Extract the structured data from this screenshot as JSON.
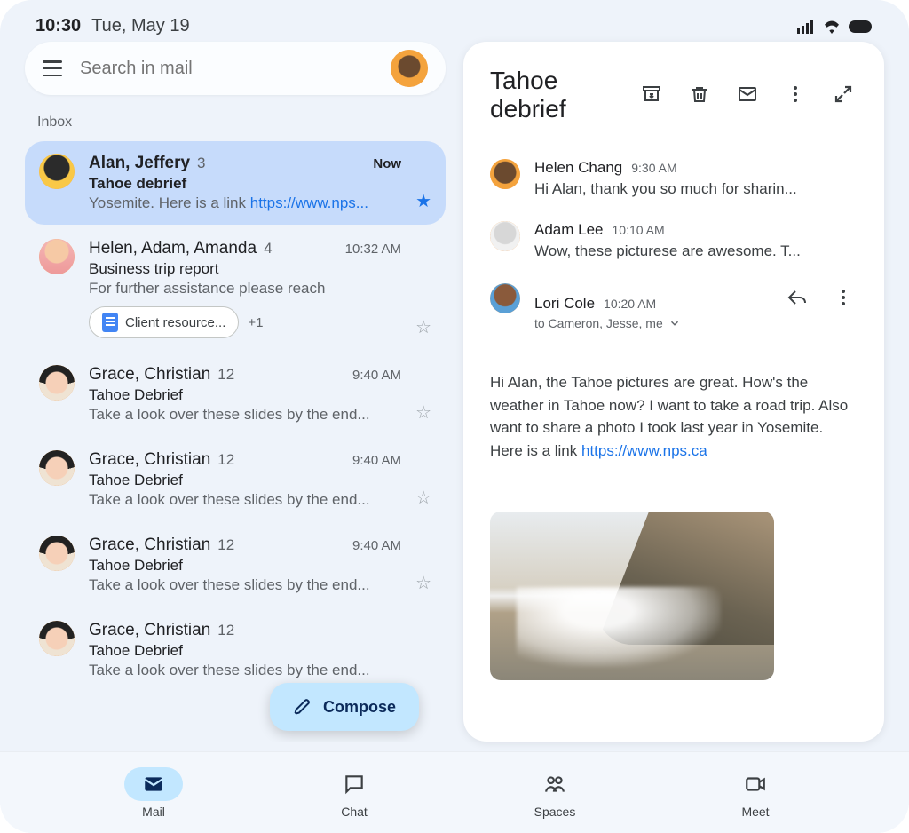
{
  "status": {
    "time": "10:30",
    "date": "Tue, May 19"
  },
  "search": {
    "placeholder": "Search in mail"
  },
  "section_label": "Inbox",
  "compose_label": "Compose",
  "threads": [
    {
      "senders": "Alan, Jeffery",
      "count": "3",
      "time": "Now",
      "subject": "Tahoe debrief",
      "snippet_prefix": "Yosemite. Here is a link ",
      "snippet_link": "https://www.nps...",
      "selected": true,
      "unread": true,
      "starred": true
    },
    {
      "senders": "Helen, Adam, Amanda",
      "count": "4",
      "time": "10:32 AM",
      "subject": "Business trip report",
      "snippet": "For further assistance please reach",
      "chip_label": "Client resource...",
      "chip_more": "+1",
      "selected": false,
      "unread": false,
      "starred": false
    },
    {
      "senders": "Grace, Christian",
      "count": "12",
      "time": "9:40 AM",
      "subject": "Tahoe Debrief",
      "snippet": "Take a look over these slides by the end...",
      "selected": false,
      "unread": false,
      "starred": false
    },
    {
      "senders": "Grace, Christian",
      "count": "12",
      "time": "9:40 AM",
      "subject": "Tahoe Debrief",
      "snippet": "Take a look over these slides by the end...",
      "selected": false,
      "unread": false,
      "starred": false
    },
    {
      "senders": "Grace, Christian",
      "count": "12",
      "time": "9:40 AM",
      "subject": "Tahoe Debrief",
      "snippet": "Take a look over these slides by the end...",
      "selected": false,
      "unread": false,
      "starred": false
    },
    {
      "senders": "Grace, Christian",
      "count": "12",
      "time": "",
      "subject": "Tahoe Debrief",
      "snippet": "Take a look over these slides by the end...",
      "selected": false,
      "unread": false,
      "starred": false
    }
  ],
  "reader": {
    "title": "Tahoe debrief",
    "body_prefix": "Hi Alan, the Tahoe pictures are great. How's the weather in Tahoe now? I want to take a road trip. Also want to share a photo I took last year in Yosemite. Here is a link ",
    "body_link": "https://www.nps.ca",
    "messages": [
      {
        "name": "Helen Chang",
        "time": "9:30 AM",
        "snippet": "Hi Alan, thank you so much for sharin..."
      },
      {
        "name": "Adam Lee",
        "time": "10:10 AM",
        "snippet": "Wow, these picturese are awesome. T..."
      },
      {
        "name": "Lori Cole",
        "time": "10:20 AM",
        "recipients": "to Cameron, Jesse, me"
      }
    ]
  },
  "nav": {
    "items": [
      {
        "label": "Mail",
        "active": true
      },
      {
        "label": "Chat",
        "active": false
      },
      {
        "label": "Spaces",
        "active": false
      },
      {
        "label": "Meet",
        "active": false
      }
    ]
  }
}
